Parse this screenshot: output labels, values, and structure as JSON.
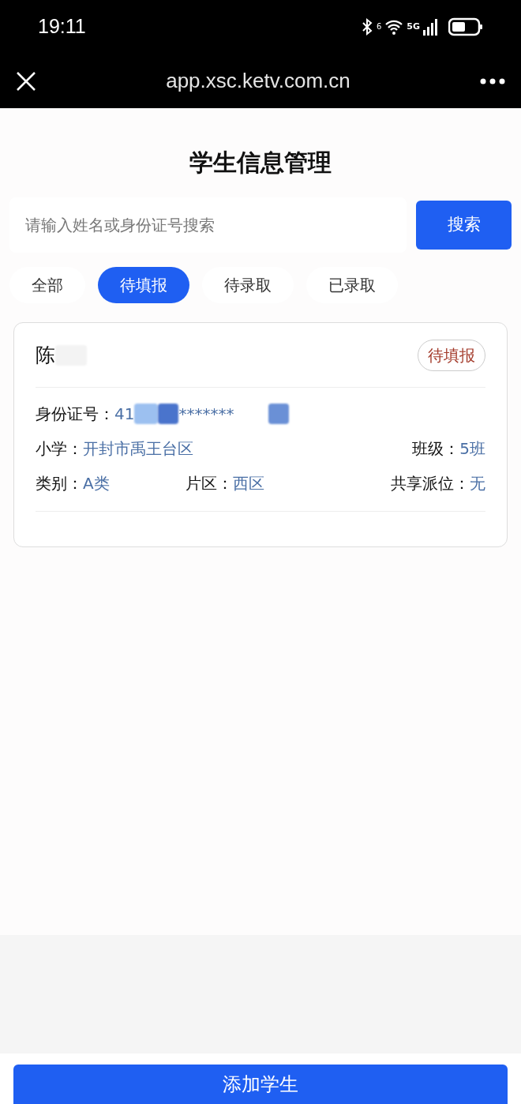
{
  "status_bar": {
    "time": "19:11",
    "wifi_badge": "6",
    "network": "5G"
  },
  "browser": {
    "url": "app.xsc.ketv.com.cn"
  },
  "title": "学生信息管理",
  "search": {
    "placeholder": "请输入姓名或身份证号搜索",
    "button": "搜索"
  },
  "tabs": [
    {
      "label": "全部",
      "selected": false
    },
    {
      "label": "待填报",
      "selected": true
    },
    {
      "label": "待录取",
      "selected": false
    },
    {
      "label": "已录取",
      "selected": false
    }
  ],
  "students": [
    {
      "name": "陈",
      "status": "待填报",
      "id_label": "身份证号：",
      "id_parts": [
        "41",
        "*******"
      ],
      "school_label": "小学：",
      "school": "开封市禹王台区",
      "class_label": "班级：",
      "class": "5班",
      "category_label": "类别：",
      "category": "A类",
      "district_label": "片区：",
      "district": "西区",
      "shared_label": "共享派位：",
      "shared": "无"
    }
  ],
  "add_button": "添加学生"
}
